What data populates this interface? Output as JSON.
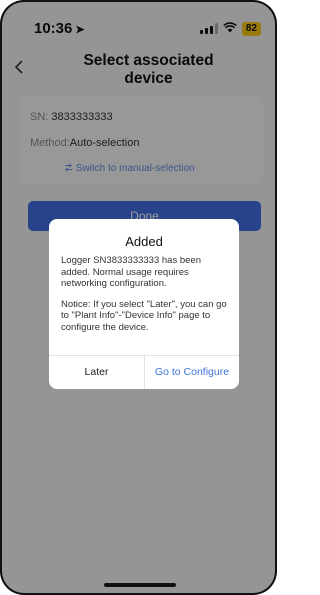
{
  "status_bar": {
    "time": "10:36",
    "location_icon": "location-arrow-icon",
    "battery": "82"
  },
  "nav": {
    "back_icon": "chevron-left-icon",
    "title": "Select associated device"
  },
  "form": {
    "sn_label": "SN:",
    "sn_value": "3833333333",
    "method_label": "Method:",
    "method_value": "Auto-selection",
    "switch_icon": "switch-icon",
    "switch_label": "Switch to manual-selection"
  },
  "done_label": "Done",
  "dialog": {
    "title": "Added",
    "message": "Logger SN3833333333 has been added. Normal usage requires networking configuration.",
    "notice": "Notice: If you select \"Later\", you can go to \"Plant Info\"-\"Device Info\" page to configure the device.",
    "later_label": "Later",
    "configure_label": "Go to Configure"
  },
  "colors": {
    "accent": "#3f6fe0",
    "link": "#3f73d9",
    "battery": "#f5c518"
  }
}
